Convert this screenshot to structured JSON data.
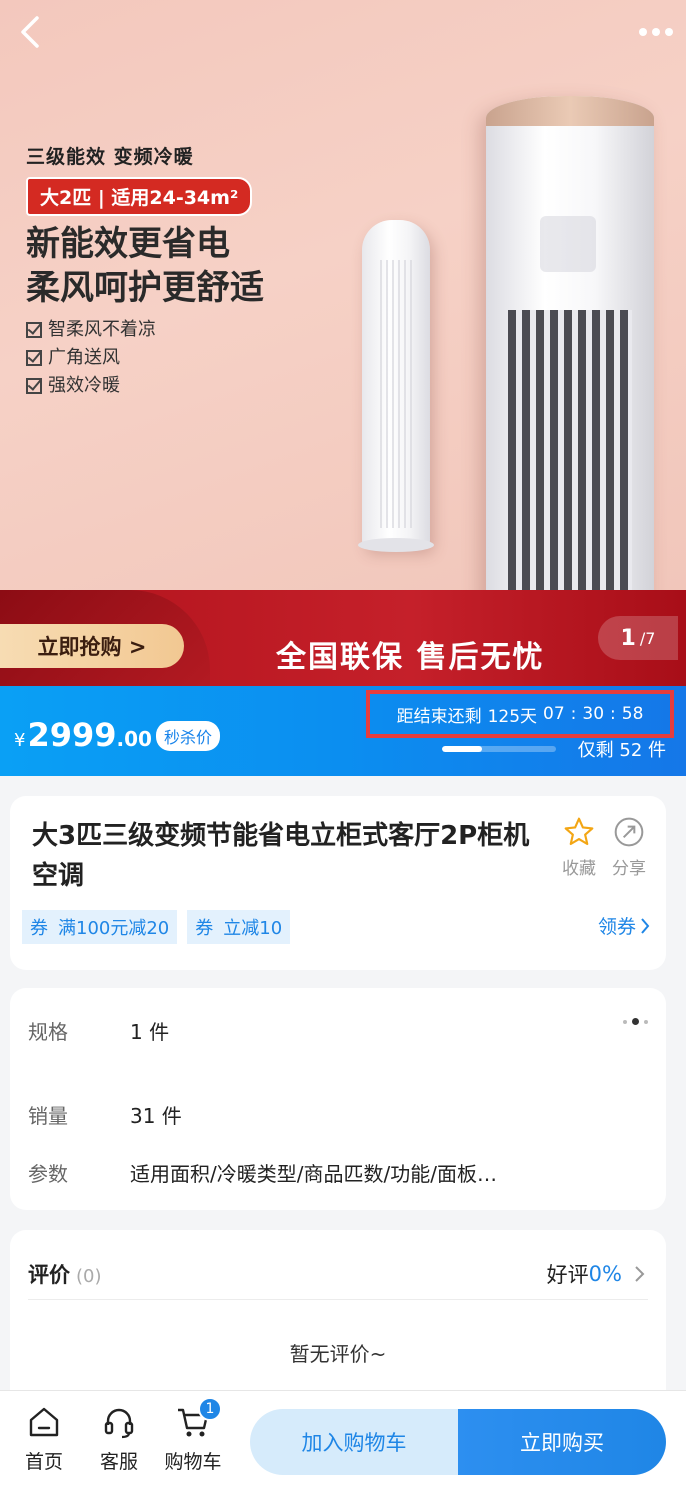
{
  "hero": {
    "subtitle": "三级能效 变频冷暖",
    "tag": "大2匹 | 适用24-34m²",
    "headline_1": "新能效更省电",
    "headline_2": "柔风呵护更舒适",
    "features": [
      "智柔风不着凉",
      "广角送风",
      "强效冷暖"
    ],
    "grab_button": "立即抢购 >",
    "slogan": "全国联保 售后无忧",
    "page_current": "1",
    "page_total": "/7",
    "icons": {
      "back": "chevron-left-icon",
      "more": "more-dots-icon"
    }
  },
  "price_bar": {
    "currency": "¥",
    "price_int": "2999",
    "price_dec": ".00",
    "badge": "秒杀价",
    "countdown_label": "距结束还剩",
    "countdown_days": "125天",
    "countdown_h": "07",
    "countdown_m": "30",
    "countdown_s": "58",
    "countdown_sep": ":",
    "stock_text": "仅剩 52 件",
    "stock_progress_percent": 35,
    "color_start": "#0aa0f5",
    "color_end": "#1577e8"
  },
  "product": {
    "title": "大3匹三级变频节能省电立柜式客厅2P柜机空调",
    "favorite_label": "收藏",
    "share_label": "分享",
    "coupons": [
      {
        "type": "券",
        "text": "满100元减20"
      },
      {
        "type": "券",
        "text": "立减10"
      }
    ],
    "get_coupon": "领券"
  },
  "spec": {
    "rows": [
      {
        "label": "规格",
        "value": "1 件"
      },
      {
        "label": "销量",
        "value": "31 件"
      },
      {
        "label": "参数",
        "value": "适用面积/冷暖类型/商品匹数/功能/面板…"
      }
    ]
  },
  "review": {
    "title": "评价",
    "count": "(0)",
    "rate_label": "好评",
    "rate_value": "0%",
    "empty": "暂无评价~"
  },
  "bottom_bar": {
    "home": "首页",
    "service": "客服",
    "cart": "购物车",
    "cart_badge": "1",
    "add_cart": "加入购物车",
    "buy_now": "立即购买",
    "accent": "#1f86e6"
  }
}
